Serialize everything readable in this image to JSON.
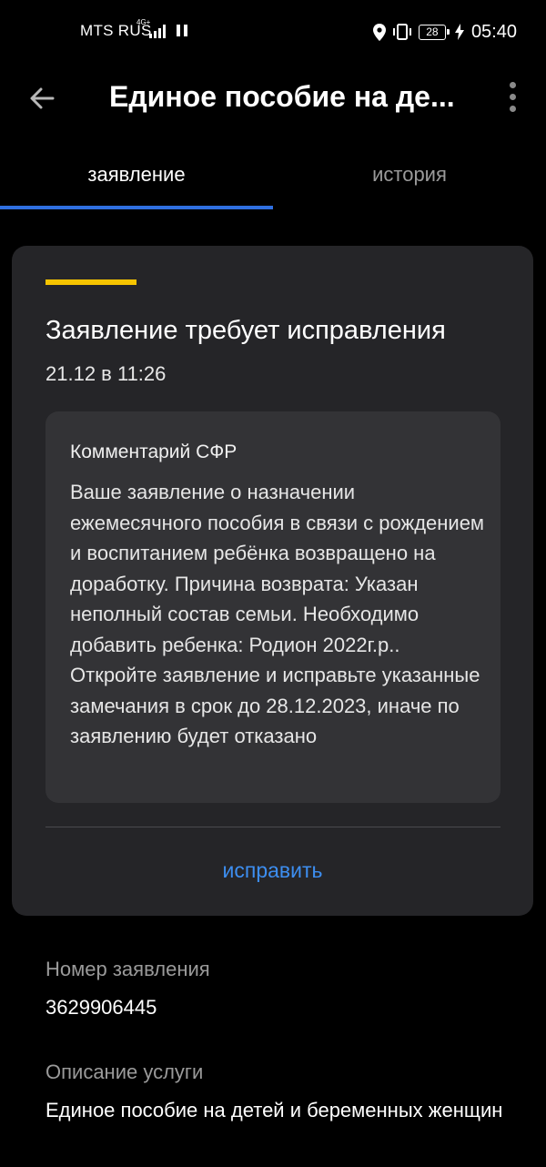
{
  "status_bar": {
    "carrier": "MTS RUS",
    "network_type": "4G+",
    "battery_level": "28",
    "time": "05:40",
    "icons": [
      "signal-icon",
      "pause-icon",
      "location-icon",
      "vibrate-icon",
      "battery-icon",
      "charging-icon"
    ]
  },
  "header": {
    "title": "Единое пособие на де...",
    "back_icon": "arrow-left-icon",
    "menu_icon": "more-vertical-icon"
  },
  "tabs": [
    {
      "label": "заявление",
      "active": true
    },
    {
      "label": "история",
      "active": false
    }
  ],
  "colors": {
    "background": "#000000",
    "card": "#252528",
    "comment_box": "#333336",
    "accent_yellow": "#f6c400",
    "tab_indicator": "#2f6fe0",
    "link_blue": "#3d8ef0",
    "muted_text": "#9a9a9a"
  },
  "status_card": {
    "title": "Заявление требует исправления",
    "date": "21.12 в 11:26",
    "comment": {
      "heading": "Комментарий СФР",
      "text": "Ваше заявление о назначении ежемесячного пособия в связи с рождением и воспитанием ребёнка возвращено на доработку. Причина возврата: Указан неполный состав семьи. Необходимо добавить ребенка: Родион 2022г.р.. Откройте заявление и исправьте указанные замечания в срок до 28.12.2023, иначе по заявлению будет отказано"
    },
    "action_label": "исправить"
  },
  "details": {
    "application_number_label": "Номер заявления",
    "application_number": "3629906445",
    "service_description_label": "Описание услуги",
    "service_description": "Единое пособие на детей и беременных женщин"
  }
}
